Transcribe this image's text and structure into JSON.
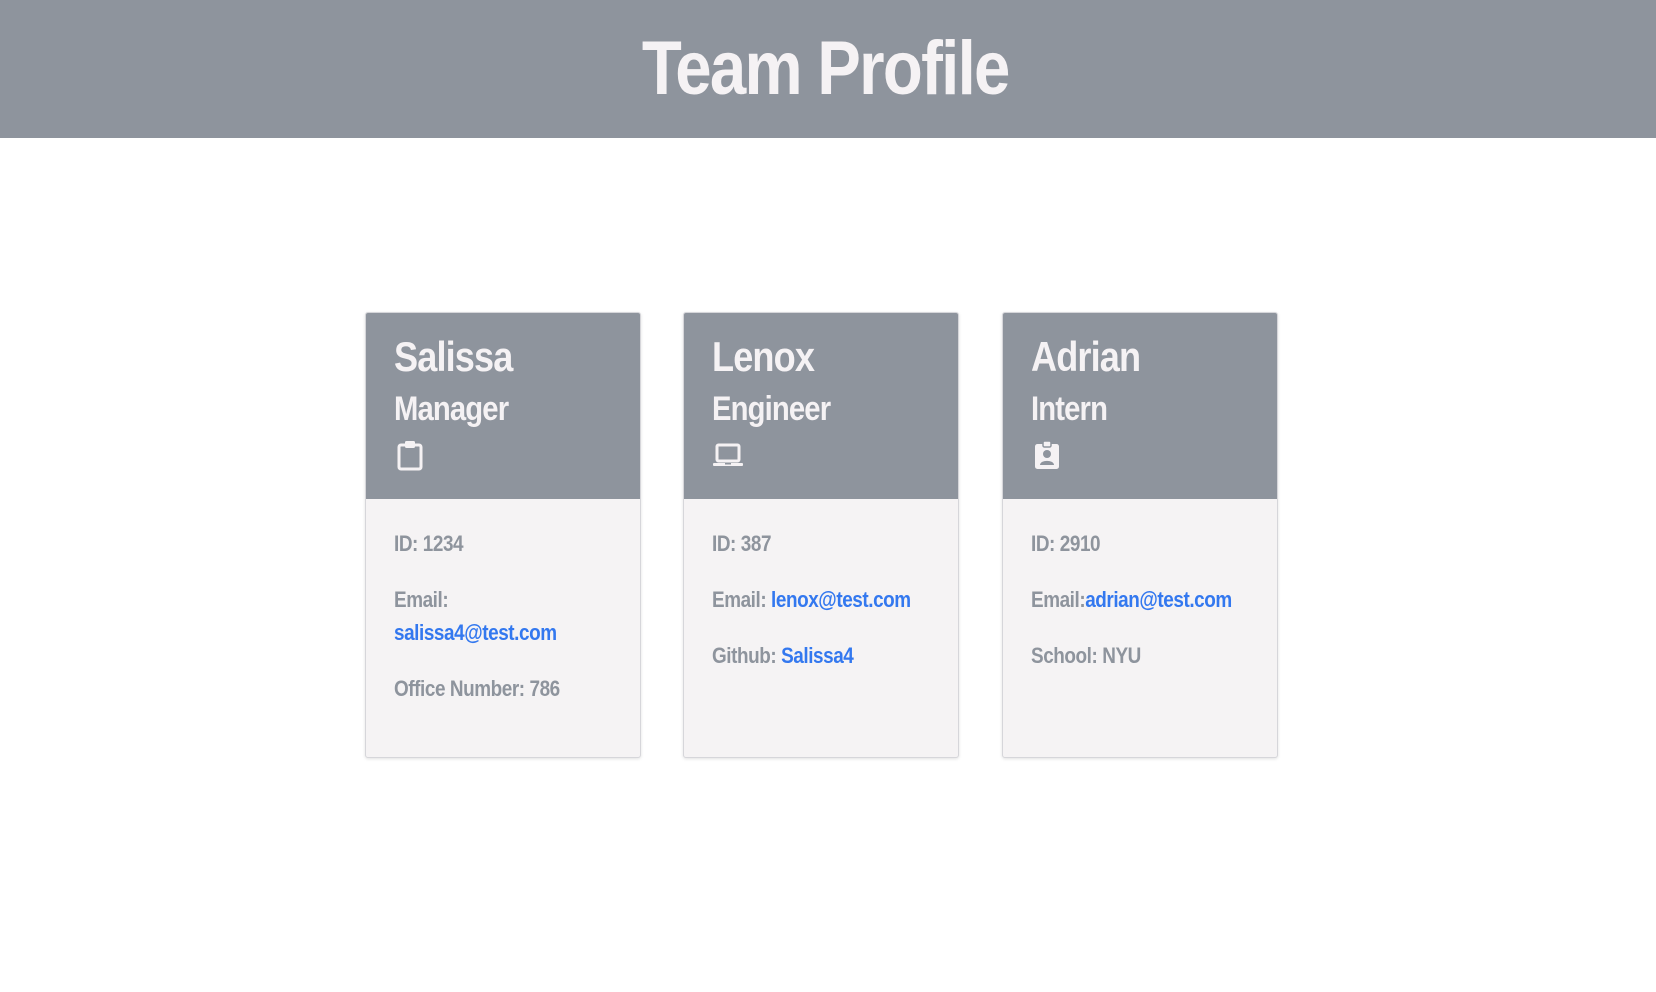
{
  "header": {
    "title": "Team Profile"
  },
  "cards": [
    {
      "name": "Salissa",
      "role": "Manager",
      "icon": "clipboard-icon",
      "id_label": "ID:",
      "id_value": "1234",
      "email_label": "Email:",
      "email_value": "salissa4@test.com",
      "extra_label": "Office Number:",
      "extra_value": "786"
    },
    {
      "name": "Lenox",
      "role": "Engineer",
      "icon": "laptop-icon",
      "id_label": "ID:",
      "id_value": "387",
      "email_label": "Email:",
      "email_value": "lenox@test.com",
      "extra_label": "Github:",
      "extra_value": "Salissa4"
    },
    {
      "name": "Adrian",
      "role": "Intern",
      "icon": "id-badge-icon",
      "id_label": "ID:",
      "id_value": "2910",
      "email_label": "Email:",
      "email_value": "adrian@test.com",
      "extra_label": "School:",
      "extra_value": "NYU"
    }
  ],
  "colors": {
    "header_bg": "#8e949d",
    "header_text": "#f5f2f4",
    "card_body_bg": "#f5f3f4",
    "body_text": "#8e949d",
    "link": "#3378ef"
  }
}
